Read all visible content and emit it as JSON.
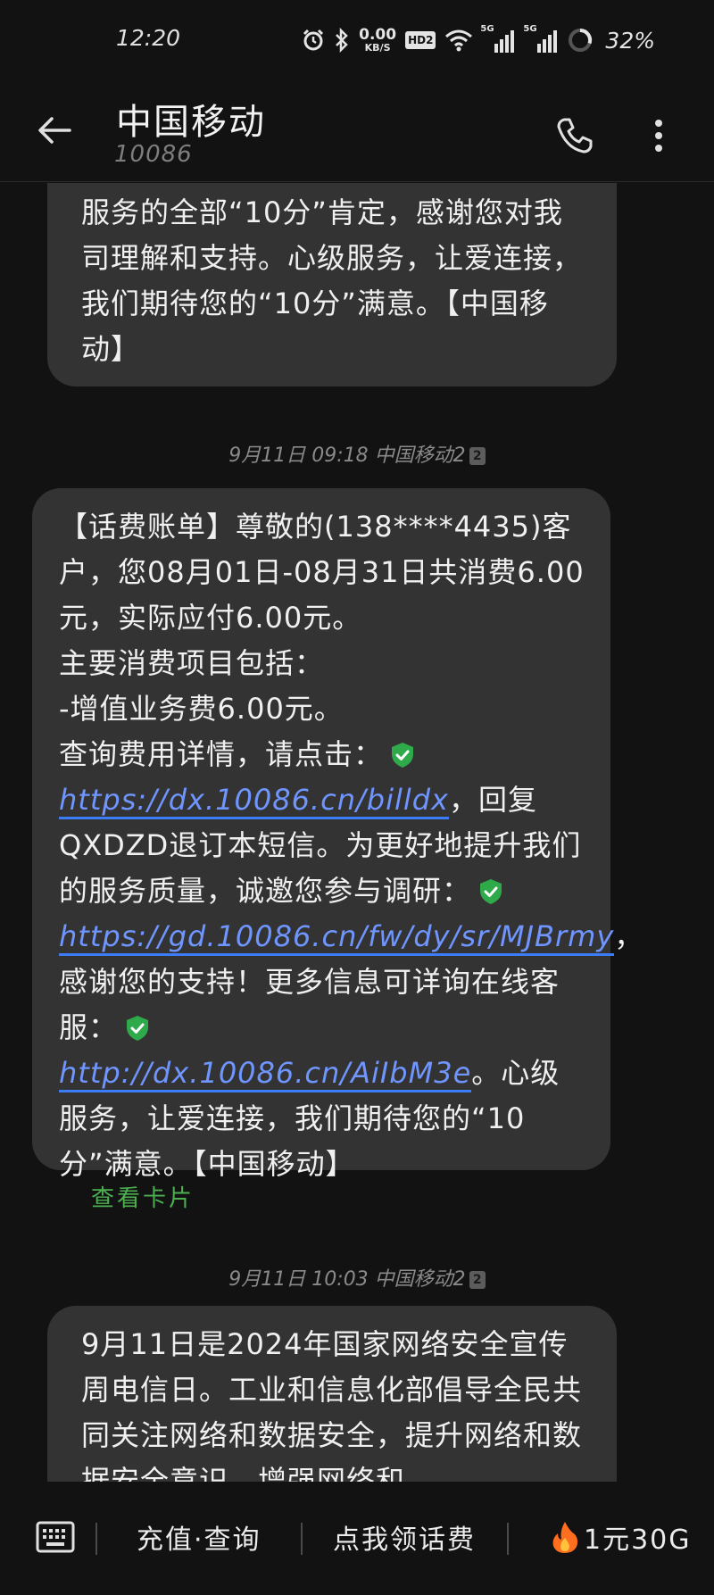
{
  "status_bar": {
    "time": "12:20",
    "net_speed_value": "0.00",
    "net_speed_unit": "KB/S",
    "hd_label": "HD2",
    "sim1_label": "5G",
    "sim2_label": "5G",
    "battery_percent": "32%"
  },
  "header": {
    "contact_name": "中国移动",
    "contact_number": "10086"
  },
  "messages": [
    {
      "text": "服务的全部“10分”肯定，感谢您对我司理解和支持。心级服务，让爱连接，我们期待您的“10分”满意。【中国移动】"
    },
    {
      "timestamp": "9月11日 09:18 中国移动2",
      "sim_badge": "2",
      "part1": "【话费账单】尊敬的(138****4435)客户，您08月01日-08月31日共消费6.00元，实际应付6.00元。",
      "part2": "主要消费项目包括：",
      "part3": "-增值业务费6.00元。",
      "part4": "查询费用详情，请点击：",
      "link1": "https://dx.10086.cn/billdx",
      "part5": "，回复QXDZD退订本短信。为更好地提升我们的服务质量，诚邀您参与调研：",
      "link2": "https://gd.10086.cn/fw/dy/sr/MJBrmy",
      "part6": "，感谢您的支持！更多信息可详询在线客服：",
      "link3": "http://dx.10086.cn/AiIbM3e",
      "part7": "。心级服务，让爱连接，我们期待您的“10分”满意。【中国移动】",
      "view_card": "查看卡片"
    },
    {
      "timestamp": "9月11日 10:03 中国移动2",
      "sim_badge": "2",
      "text": "9月11日是2024年国家网络安全宣传周电信日。工业和信息化部倡导全民共同关注网络和数据安全，提升网络和数据安全意识，增强网络和"
    }
  ],
  "bottom_bar": {
    "item1": "充值·查询",
    "item2": "点我领话费",
    "item3": "1元30G"
  },
  "colors": {
    "background": "#121212",
    "bubble": "#333333",
    "link": "#6f95ff",
    "link_underline": "#3d7cf7",
    "safe_shield": "#2eaa4a",
    "view_card": "#4caf50"
  }
}
